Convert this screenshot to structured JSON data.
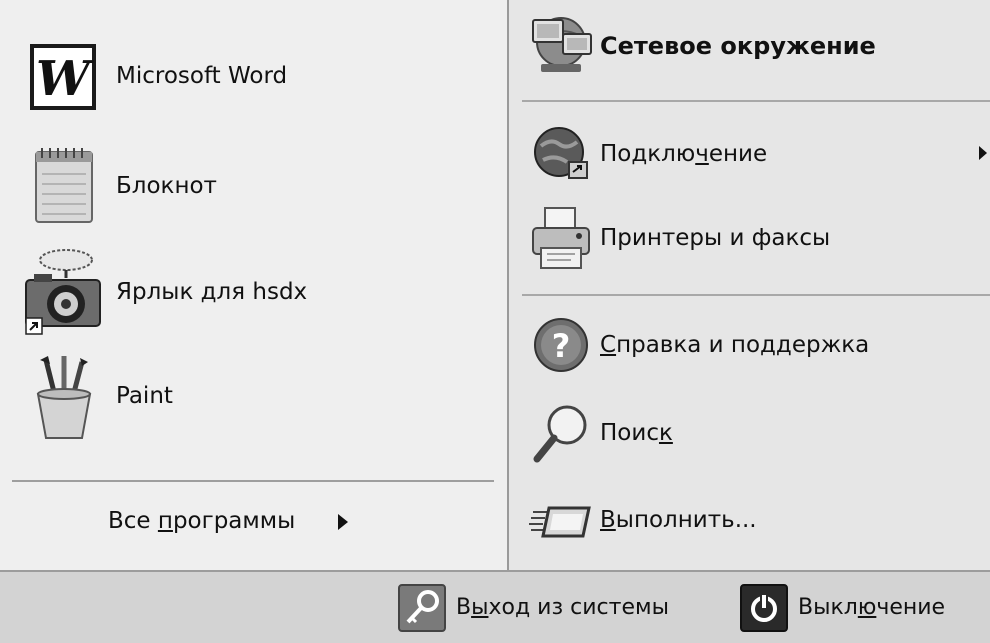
{
  "programs": [
    {
      "label": "Microsoft Word",
      "icon": "word-icon"
    },
    {
      "label": "Блокнот",
      "icon": "notepad-icon"
    },
    {
      "label": "Ярлык для hsdx",
      "icon": "camera-icon"
    },
    {
      "label": "Paint",
      "icon": "paint-icon"
    }
  ],
  "all_programs": {
    "label_before": "Все ",
    "label_mnemonic": "п",
    "label_after": "рограммы"
  },
  "places": [
    {
      "label": "Сетевое окружение",
      "icon": "network-icon",
      "bold": true
    },
    {
      "label_before": "Подклю",
      "label_mnemonic": "ч",
      "label_after": "ение",
      "icon": "globe-connect-icon",
      "has_submenu": true
    },
    {
      "label": "Принтеры и факсы",
      "icon": "printer-icon"
    },
    {
      "label_before": "",
      "label_mnemonic": "С",
      "label_after": "правка и поддержка",
      "icon": "help-icon"
    },
    {
      "label_before": "Поис",
      "label_mnemonic": "к",
      "label_after": "",
      "icon": "search-icon"
    },
    {
      "label_before": "",
      "label_mnemonic": "В",
      "label_after": "ыполнить...",
      "icon": "run-icon"
    }
  ],
  "bottom": {
    "logoff": {
      "label_before": "В",
      "label_mnemonic": "ы",
      "label_after": "ход из системы",
      "icon": "key-icon"
    },
    "shutdown": {
      "label_before": "Выкл",
      "label_mnemonic": "ю",
      "label_after": "чение",
      "icon": "power-icon"
    }
  }
}
